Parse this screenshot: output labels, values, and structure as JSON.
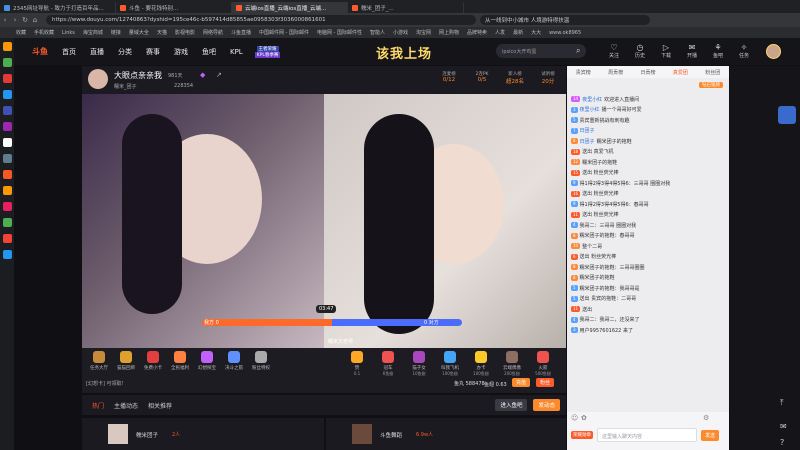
{
  "browser": {
    "tabs": [
      {
        "label": "2345网址导航 - 致力于打造百年品...",
        "color": "#4a90e2",
        "active": false
      },
      {
        "label": "斗鱼 - 要花钱特别...",
        "color": "#ff5b2b",
        "active": false
      },
      {
        "label": "云端ios直播_云端ios直播_云端...",
        "color": "#ff5b2b",
        "active": true
      },
      {
        "label": "糯米_团子_...",
        "color": "#ff5b2b",
        "active": false
      }
    ],
    "url": "https://www.douyu.com/12740863?dyshid=195ce46c-b597414d85855ae0958303f3036000861601",
    "search_placeholder": "从一线到中小城市 人境游特得扶温",
    "bookmarks": [
      "收藏",
      "手机收藏",
      "Links",
      "海宝商城",
      "链接",
      "量域大全",
      "天猫",
      "影视电影",
      "网络导航",
      "斗鱼直播",
      "中国邮件网 - 国际邮件",
      "电脑网 - 国际邮件性",
      "智能人",
      "小游戏",
      "淘宝网",
      "网上购物",
      "品牌特卖",
      "人发",
      "最新",
      "大大",
      "www.ok8965"
    ]
  },
  "sidebar_icons": [
    "#ff9800",
    "#4caf50",
    "#e53935",
    "#2196f3",
    "#3f51b5",
    "#9c27b0",
    "#fff",
    "#607d8b",
    "#ff5722",
    "#ff9800",
    "#e91e63",
    "#4caf50",
    "#f44336",
    "#2196f3"
  ],
  "site": {
    "logo": "斗鱼",
    "nav": [
      "首页",
      "直播",
      "分类",
      "赛事",
      "游戏",
      "鱼吧",
      "KPL"
    ],
    "kpl_badge": "王者荣耀",
    "kpl_sub": "KPL春季赛",
    "promo": "该我上场",
    "search_placeholder": "ipsico大开鸡蛋",
    "header_icons": [
      {
        "glyph": "♡",
        "label": "关注",
        "name": "follow-icon"
      },
      {
        "glyph": "◷",
        "label": "历史",
        "name": "history-icon"
      },
      {
        "glyph": "▷",
        "label": "下载",
        "name": "download-icon"
      },
      {
        "glyph": "✉",
        "label": "开播",
        "name": "broadcast-icon"
      },
      {
        "glyph": "⚘",
        "label": "鱼吧",
        "name": "fishbar-icon"
      },
      {
        "glyph": "✧",
        "label": "任务",
        "name": "task-icon"
      }
    ]
  },
  "room": {
    "streamer_name": "大眼点亲亲我",
    "level": "981天",
    "room_id": "228354",
    "subtitle": "糯米_团子",
    "stats": [
      {
        "label": "连麦榜",
        "value": "0/12"
      },
      {
        "label": "2连PK",
        "value": "0/5"
      },
      {
        "label": "新人榜",
        "value": "超28名"
      },
      {
        "label": "试听榜",
        "value": "20分"
      }
    ],
    "pk_left_label": "我方 0",
    "pk_right_label": "0 对方",
    "pk_left_share": 0.5,
    "pk_timer": "03:47",
    "opponent_name": "糯米文老师",
    "left_host": "主播",
    "right_host": "对方"
  },
  "gifts_left": [
    {
      "label": "任务大厅",
      "color": "#c98a3a"
    },
    {
      "label": "猫猫回绑",
      "color": "#e0a030"
    },
    {
      "label": "免费小卡",
      "color": "#e04040"
    },
    {
      "label": "全民福利",
      "color": "#ff8040"
    },
    {
      "label": "幻想探宝",
      "color": "#c060ff"
    },
    {
      "label": "决斗之箭",
      "color": "#6090ff"
    },
    {
      "label": "粉丝特权",
      "color": "#aaa"
    }
  ],
  "gifts_right": [
    {
      "label": "赞",
      "price": "0.1",
      "color": "#ffa726"
    },
    {
      "label": "冠车",
      "price": "6鱼翅",
      "color": "#ef5350"
    },
    {
      "label": "猫子女",
      "price": "10鱼翅",
      "color": "#ab47bc"
    },
    {
      "label": "叫我飞机",
      "price": "100鱼翅",
      "color": "#42a5f5"
    },
    {
      "label": "办卡",
      "price": "100鱼翅",
      "color": "#ffca28"
    },
    {
      "label": "云端偶像",
      "price": "200鱼翅",
      "color": "#8d6e63"
    },
    {
      "label": "火箭",
      "price": "500鱼翅",
      "color": "#ef5350"
    }
  ],
  "wallet": {
    "fish_ball": "鱼丸 588478",
    "fish_fin": "鱼翅 0.63",
    "recharge": "充值",
    "fans": "粉丝"
  },
  "left_subinfo": "[幻想卡] 可领取!",
  "lower_tabs": [
    "热门",
    "主播动态",
    "相关推荐"
  ],
  "lower_buttons": [
    "进入鱼吧",
    "发动态"
  ],
  "recommend": [
    {
      "name": "糯米团子",
      "tag": "2人"
    },
    {
      "name": "斗鱼舞蹈",
      "tag": "6.9w人"
    }
  ],
  "chat": {
    "rank_tabs": [
      "贵宾榜",
      "周贡榜",
      "日贡榜",
      "真爱团",
      "粉丝团"
    ],
    "active_tab": 3,
    "top_label": "钻石铭牌",
    "messages": [
      {
        "badge": "#d45cff",
        "badge_text": "14",
        "name": "夜里小红",
        "text": "欢迎进入直播间"
      },
      {
        "badge": "#5ca0ff",
        "badge_text": "3",
        "name": "夜里小红",
        "text": "播一个哥哥好可爱"
      },
      {
        "badge": "#5ca0ff",
        "badge_text": "5",
        "name": "",
        "text": "贵宾重新挑战有刺有趣"
      },
      {
        "badge": "#5ca0ff",
        "badge_text": "7",
        "name": "日团子",
        "text": ""
      },
      {
        "badge": "#ff8a3a",
        "badge_text": "8",
        "name": "日团子",
        "text": "糯米团子的拖鞋"
      },
      {
        "badge": "#ff5b2b",
        "badge_text": "18",
        "name": "",
        "text": "送出 真爱飞机"
      },
      {
        "badge": "#ff8a3a",
        "badge_text": "12",
        "name": "",
        "text": "糯米团子的拖鞋"
      },
      {
        "badge": "#ff5b2b",
        "badge_text": "15",
        "name": "",
        "text": "送出 粉丝荧光棒"
      },
      {
        "badge": "#5ca0ff",
        "badge_text": "9",
        "name": "",
        "text": "得1得2得3得4得5得6：三哥哥 圈圈对我"
      },
      {
        "badge": "#ff5b2b",
        "badge_text": "16",
        "name": "",
        "text": "送出 粉丝荧光棒"
      },
      {
        "badge": "#5ca0ff",
        "badge_text": "9",
        "name": "",
        "text": "得1得2得3得4得5得6：春哥哥"
      },
      {
        "badge": "#ff5b2b",
        "badge_text": "11",
        "name": "",
        "text": "送出 粉丝荧光棒"
      },
      {
        "badge": "#5ca0ff",
        "badge_text": "4",
        "name": "",
        "text": "我哥二：三哥哥 圈圈对我"
      },
      {
        "badge": "#ff8a3a",
        "badge_text": "8",
        "name": "",
        "text": "糯米团子的拖鞋：春哥哥"
      },
      {
        "badge": "#ff8a3a",
        "badge_text": "10",
        "name": "",
        "text": "整个二哥"
      },
      {
        "badge": "#ff5b2b",
        "badge_text": "6",
        "name": "",
        "text": "送出 粉丝荧光棒"
      },
      {
        "badge": "#ff8a3a",
        "badge_text": "8",
        "name": "",
        "text": "糯米团子的拖鞋：三哥哥圈圈"
      },
      {
        "badge": "#ff8a3a",
        "badge_text": "8",
        "name": "",
        "text": "糯米团子的拖鞋"
      },
      {
        "badge": "#5ca0ff",
        "badge_text": "5",
        "name": "",
        "text": "糯米团子的拖鞋：我哥哥是"
      },
      {
        "badge": "#5ca0ff",
        "badge_text": "5",
        "name": "",
        "text": "送出 贵宾的拖鞋：二哥哥"
      },
      {
        "badge": "#ff5b2b",
        "badge_text": "11",
        "name": "",
        "text": "送出"
      },
      {
        "badge": "#5ca0ff",
        "badge_text": "4",
        "name": "",
        "text": "我哥二：我哥二，还没来了"
      },
      {
        "badge": "#5ca0ff",
        "badge_text": "3",
        "name": "",
        "text": "用户9957601622 来了"
      }
    ],
    "input_placeholder": "这里输入聊天内容",
    "send": "发送",
    "bottom_badge": "荣耀勋章"
  },
  "colors": {
    "accent": "#ff5b2b",
    "pk_left": "#ff6a2b",
    "pk_right": "#4a6cff",
    "chat_bg": "#ededf0"
  }
}
